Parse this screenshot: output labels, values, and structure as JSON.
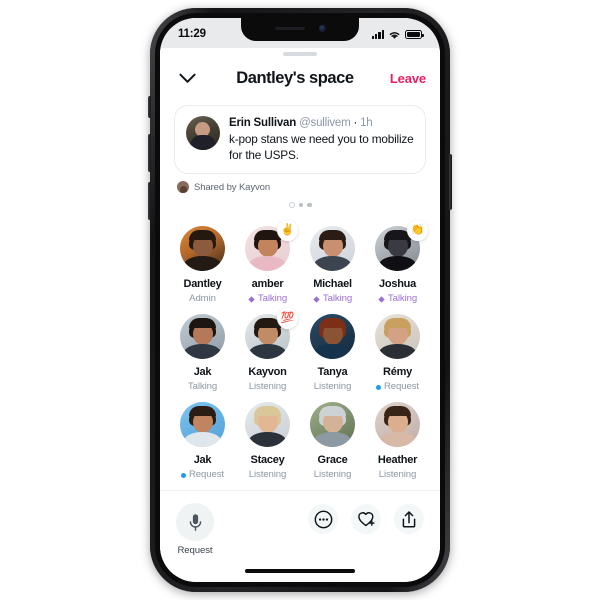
{
  "status_bar": {
    "time": "11:29",
    "signal_icon": "cellular-signal-icon",
    "wifi_icon": "wifi-icon",
    "battery_icon": "battery-icon"
  },
  "header": {
    "collapse_icon": "chevron-down-icon",
    "title": "Dantley's space",
    "leave_label": "Leave",
    "leave_color": "#ea1e63"
  },
  "tweet_card": {
    "author": "Erin Sullivan",
    "handle": "@sullivem",
    "separator": " · ",
    "time": "1h",
    "body": "k-pop stans we need you to mobilize for the USPS.",
    "avatar_name": "tweet-author-avatar"
  },
  "shared_by": {
    "label": "Shared by Kayvon",
    "avatar_name": "shared-by-avatar"
  },
  "page_dots": {
    "count": 3,
    "active_index": 0
  },
  "participants": [
    {
      "name": "Dantley",
      "status": "Admin",
      "status_type": "admin",
      "emoji": "",
      "avatar": "dantley"
    },
    {
      "name": "amber",
      "status": "Talking",
      "status_type": "talking",
      "emoji": "✌️",
      "avatar": "amber"
    },
    {
      "name": "Michael",
      "status": "Talking",
      "status_type": "talking",
      "emoji": "",
      "avatar": "michael"
    },
    {
      "name": "Joshua",
      "status": "Talking",
      "status_type": "talking",
      "emoji": "👏",
      "avatar": "joshua"
    },
    {
      "name": "Jak",
      "status": "Talking",
      "status_type": "plain",
      "emoji": "",
      "avatar": "jak1"
    },
    {
      "name": "Kayvon",
      "status": "Listening",
      "status_type": "plain",
      "emoji": "💯",
      "avatar": "kayvon"
    },
    {
      "name": "Tanya",
      "status": "Listening",
      "status_type": "plain",
      "emoji": "",
      "avatar": "tanya"
    },
    {
      "name": "Rémy",
      "status": "Request",
      "status_type": "request",
      "emoji": "",
      "avatar": "remy"
    },
    {
      "name": "Jak",
      "status": "Request",
      "status_type": "request",
      "emoji": "",
      "avatar": "jak2"
    },
    {
      "name": "Stacey",
      "status": "Listening",
      "status_type": "plain",
      "emoji": "",
      "avatar": "stacey"
    },
    {
      "name": "Grace",
      "status": "Listening",
      "status_type": "plain",
      "emoji": "",
      "avatar": "grace"
    },
    {
      "name": "Heather",
      "status": "Listening",
      "status_type": "plain",
      "emoji": "",
      "avatar": "heather"
    }
  ],
  "bottom_bar": {
    "mic_icon": "microphone-icon",
    "mic_label": "Request",
    "more_icon": "more-options-icon",
    "heart_plus_icon": "heart-plus-icon",
    "share_icon": "share-icon"
  },
  "colors": {
    "talking_purple": "#9b6fd4",
    "request_blue": "#1d9bf0",
    "leave_pink": "#ea1e63",
    "muted_gray": "#8b98a5",
    "text_dark": "#0f1419"
  }
}
